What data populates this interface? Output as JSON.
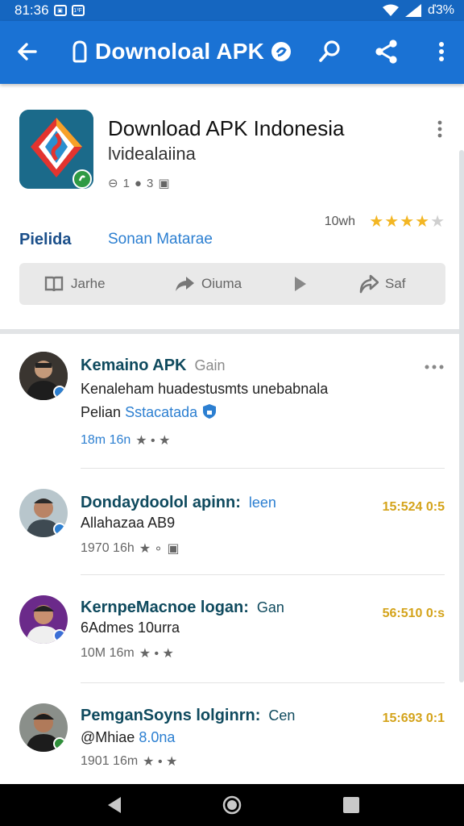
{
  "status_bar": {
    "time": "81:36",
    "notif_badge": "1³F",
    "battery": "ď3%"
  },
  "app_bar": {
    "title": "Downoloal APK",
    "icons": [
      "back-arrow-icon",
      "bag-icon",
      "shield-badge-icon",
      "search-icon",
      "share-icon",
      "more-vert-icon"
    ],
    "color": "#1a72d4"
  },
  "app_detail": {
    "name": "Download APK Indonesia",
    "developer": "lvidealaiina",
    "meta_a": "1",
    "meta_b": "3",
    "rating_count": "10wh",
    "rating_stars": 4,
    "rating_max": 5,
    "tab_active": "Pielida",
    "tab_other": "Sonan Matarae",
    "actions": [
      {
        "label": "Jarhe",
        "icon": "book-icon"
      },
      {
        "label": "Oiuma",
        "icon": "forward-arrow-icon"
      },
      {
        "label": "",
        "icon": "play-icon"
      },
      {
        "label": "Saf",
        "icon": "reply-share-icon"
      }
    ]
  },
  "feed": [
    {
      "title": "Kemaino APK",
      "title_suffix": "Gain",
      "line1": "Kenaleham huadestusmts unebabnala",
      "line2_prefix": "Pelian",
      "line2_link": "Sstacatada",
      "meta": "18m 16n",
      "meta_extra": "★ • ★",
      "time": "",
      "badge_color": "#2c7fd1"
    },
    {
      "title": "Dondaydoolol apinn:",
      "title_suffix": "leen",
      "line1": "Allahazaa AB9",
      "line2_prefix": "",
      "line2_link": "",
      "meta": "1970 16h",
      "meta_extra": "★ ∘",
      "time": "15:524 0:5",
      "badge_color": "#2c7fd1"
    },
    {
      "title": "KernpeMacnoe logan:",
      "title_suffix": "Gan",
      "line1": "6Admes 10urra",
      "line2_prefix": "",
      "line2_link": "",
      "meta": "10M 16m",
      "meta_extra": "★ • ★",
      "time": "56:510 0:s",
      "badge_color": "#3b6fd6"
    },
    {
      "title": "PemganSoyns lolginrn:",
      "title_suffix": "Cen",
      "line1": "@Mhiae",
      "line2_prefix": "",
      "line2_link": "8.0na",
      "meta": "1901 16m",
      "meta_extra": "★ • ★",
      "time": "15:693 0:1",
      "badge_color": "#2f8f3a"
    }
  ],
  "nav_bar": {
    "icons": [
      "nav-back-icon",
      "nav-home-icon",
      "nav-recents-icon"
    ]
  }
}
